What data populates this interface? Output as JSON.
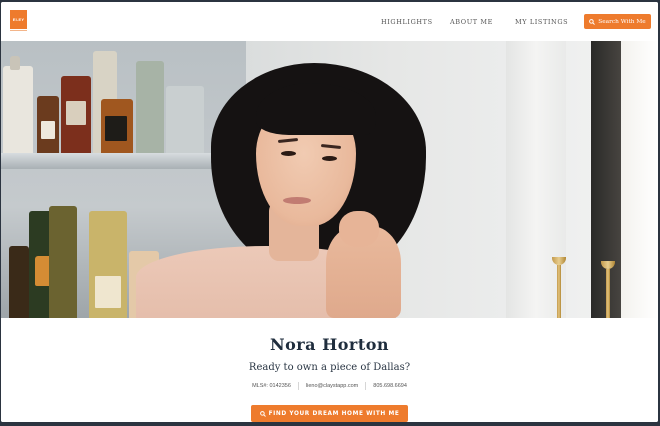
{
  "brand": {
    "logo_text": "EI-EY",
    "accent_color": "#ee7b2d"
  },
  "nav": {
    "links": [
      {
        "label": "Highlights"
      },
      {
        "label": "About Me"
      },
      {
        "label": "My Listings"
      }
    ],
    "search_button": {
      "label": "Search With Me",
      "icon": "search-icon"
    }
  },
  "hero": {
    "image": "portrait-photo"
  },
  "profile": {
    "name": "Nora Horton",
    "tagline": "Ready to own a piece of Dallas?",
    "mls": "MLS#: 0142356",
    "email": "lieno@claystapp.com",
    "phone": "805.698.6694",
    "cta": {
      "label": "FIND YOUR DREAM HOME WITH ME",
      "icon": "search-icon"
    }
  }
}
